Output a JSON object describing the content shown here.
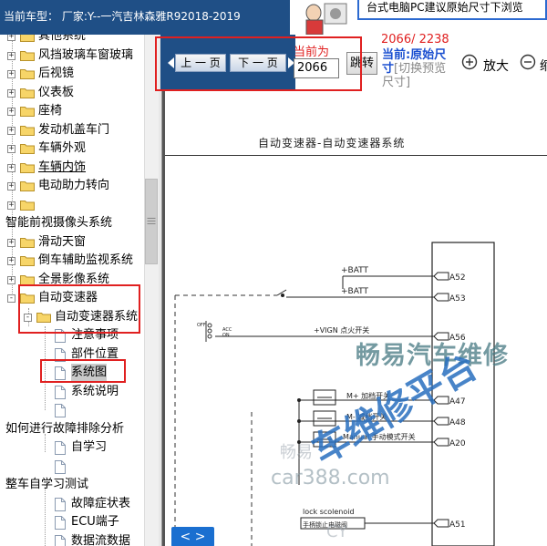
{
  "header": {
    "car_model": "当前车型：  厂家:Y--一汽吉林森雅R92018-2019",
    "ad_text": "台式电脑PC建议原始尺寸下浏览"
  },
  "tree": {
    "items": [
      {
        "label": "其他系统",
        "kind": "folder",
        "expander": "+"
      },
      {
        "label": "风挡玻璃车窗玻璃",
        "kind": "folder",
        "expander": "+"
      },
      {
        "label": "后视镜",
        "kind": "folder",
        "expander": "+"
      },
      {
        "label": "仪表板",
        "kind": "folder",
        "expander": "+"
      },
      {
        "label": "座椅",
        "kind": "folder",
        "expander": "+"
      },
      {
        "label": "发动机盖车门",
        "kind": "folder",
        "expander": "+"
      },
      {
        "label": "车辆外观",
        "kind": "folder",
        "expander": "+"
      },
      {
        "label": "车辆内饰",
        "kind": "folder",
        "expander": "+"
      },
      {
        "label": "电动助力转向",
        "kind": "folder",
        "expander": "+"
      },
      {
        "label": "",
        "kind": "folder",
        "expander": "+"
      },
      {
        "label": "智能前视摄像头系统",
        "kind": "text"
      },
      {
        "label": "滑动天窗",
        "kind": "folder",
        "expander": "+"
      },
      {
        "label": "倒车辅助监视系统",
        "kind": "folder",
        "expander": "+"
      },
      {
        "label": "全景影像系统",
        "kind": "folder",
        "expander": "+"
      },
      {
        "label": "自动变速器",
        "kind": "folder",
        "expander": "-"
      },
      {
        "label": "自动变速器系统",
        "kind": "folder",
        "expander": "-"
      },
      {
        "label": "注意事项",
        "kind": "doc"
      },
      {
        "label": "部件位置",
        "kind": "doc"
      },
      {
        "label": "系统图",
        "kind": "doc"
      },
      {
        "label": "系统说明",
        "kind": "doc"
      },
      {
        "label": "",
        "kind": "doc"
      },
      {
        "label": "如何进行故障排除分析",
        "kind": "text"
      },
      {
        "label": "自学习",
        "kind": "doc"
      },
      {
        "label": "",
        "kind": "doc"
      },
      {
        "label": "整车自学习测试",
        "kind": "text"
      },
      {
        "label": "故障症状表",
        "kind": "doc"
      },
      {
        "label": "ECU端子",
        "kind": "doc"
      },
      {
        "label": "数据流数据",
        "kind": "doc"
      }
    ]
  },
  "toolbar": {
    "prev_label": "上 一 页",
    "next_label": "下 一 页",
    "current_label": "当前为",
    "current_page": "2066",
    "go_label": "跳转",
    "page_count": "2066/ 2238",
    "current_size_label": "当前:原始尺寸",
    "switch_label": "[切换预览尺寸]",
    "zoom_in_label": "放大",
    "zoom_out_label": "缩"
  },
  "document": {
    "title": "自动变速器-自动变速器系统",
    "labels": {
      "batt1": "+BATT",
      "batt2": "+BATT",
      "vign": "+VIGN 点火开关",
      "off": "OFF",
      "acc": "ACC",
      "on": "ON",
      "mplus": "M+ 加档开关",
      "mminus": "M- 减档开关",
      "manual": "Manual 手动模式开关",
      "lock": "lock scolenoid",
      "lock_cn": "手柄锁止电磁阀",
      "a52": "A52",
      "a53": "A53",
      "a56": "A56",
      "a47": "A47",
      "a48": "A48",
      "a20": "A20",
      "a51": "A51"
    },
    "watermarks": {
      "brand": "畅易汽车维修",
      "site": "car388.com",
      "yi": "畅易",
      "platform": "车维修平台",
      "cy": "CY"
    },
    "nav_arrows": "< >"
  },
  "colors": {
    "header_blue": "#1f4f86",
    "highlight_red": "#e02020",
    "link_blue": "#1a4fd0"
  }
}
